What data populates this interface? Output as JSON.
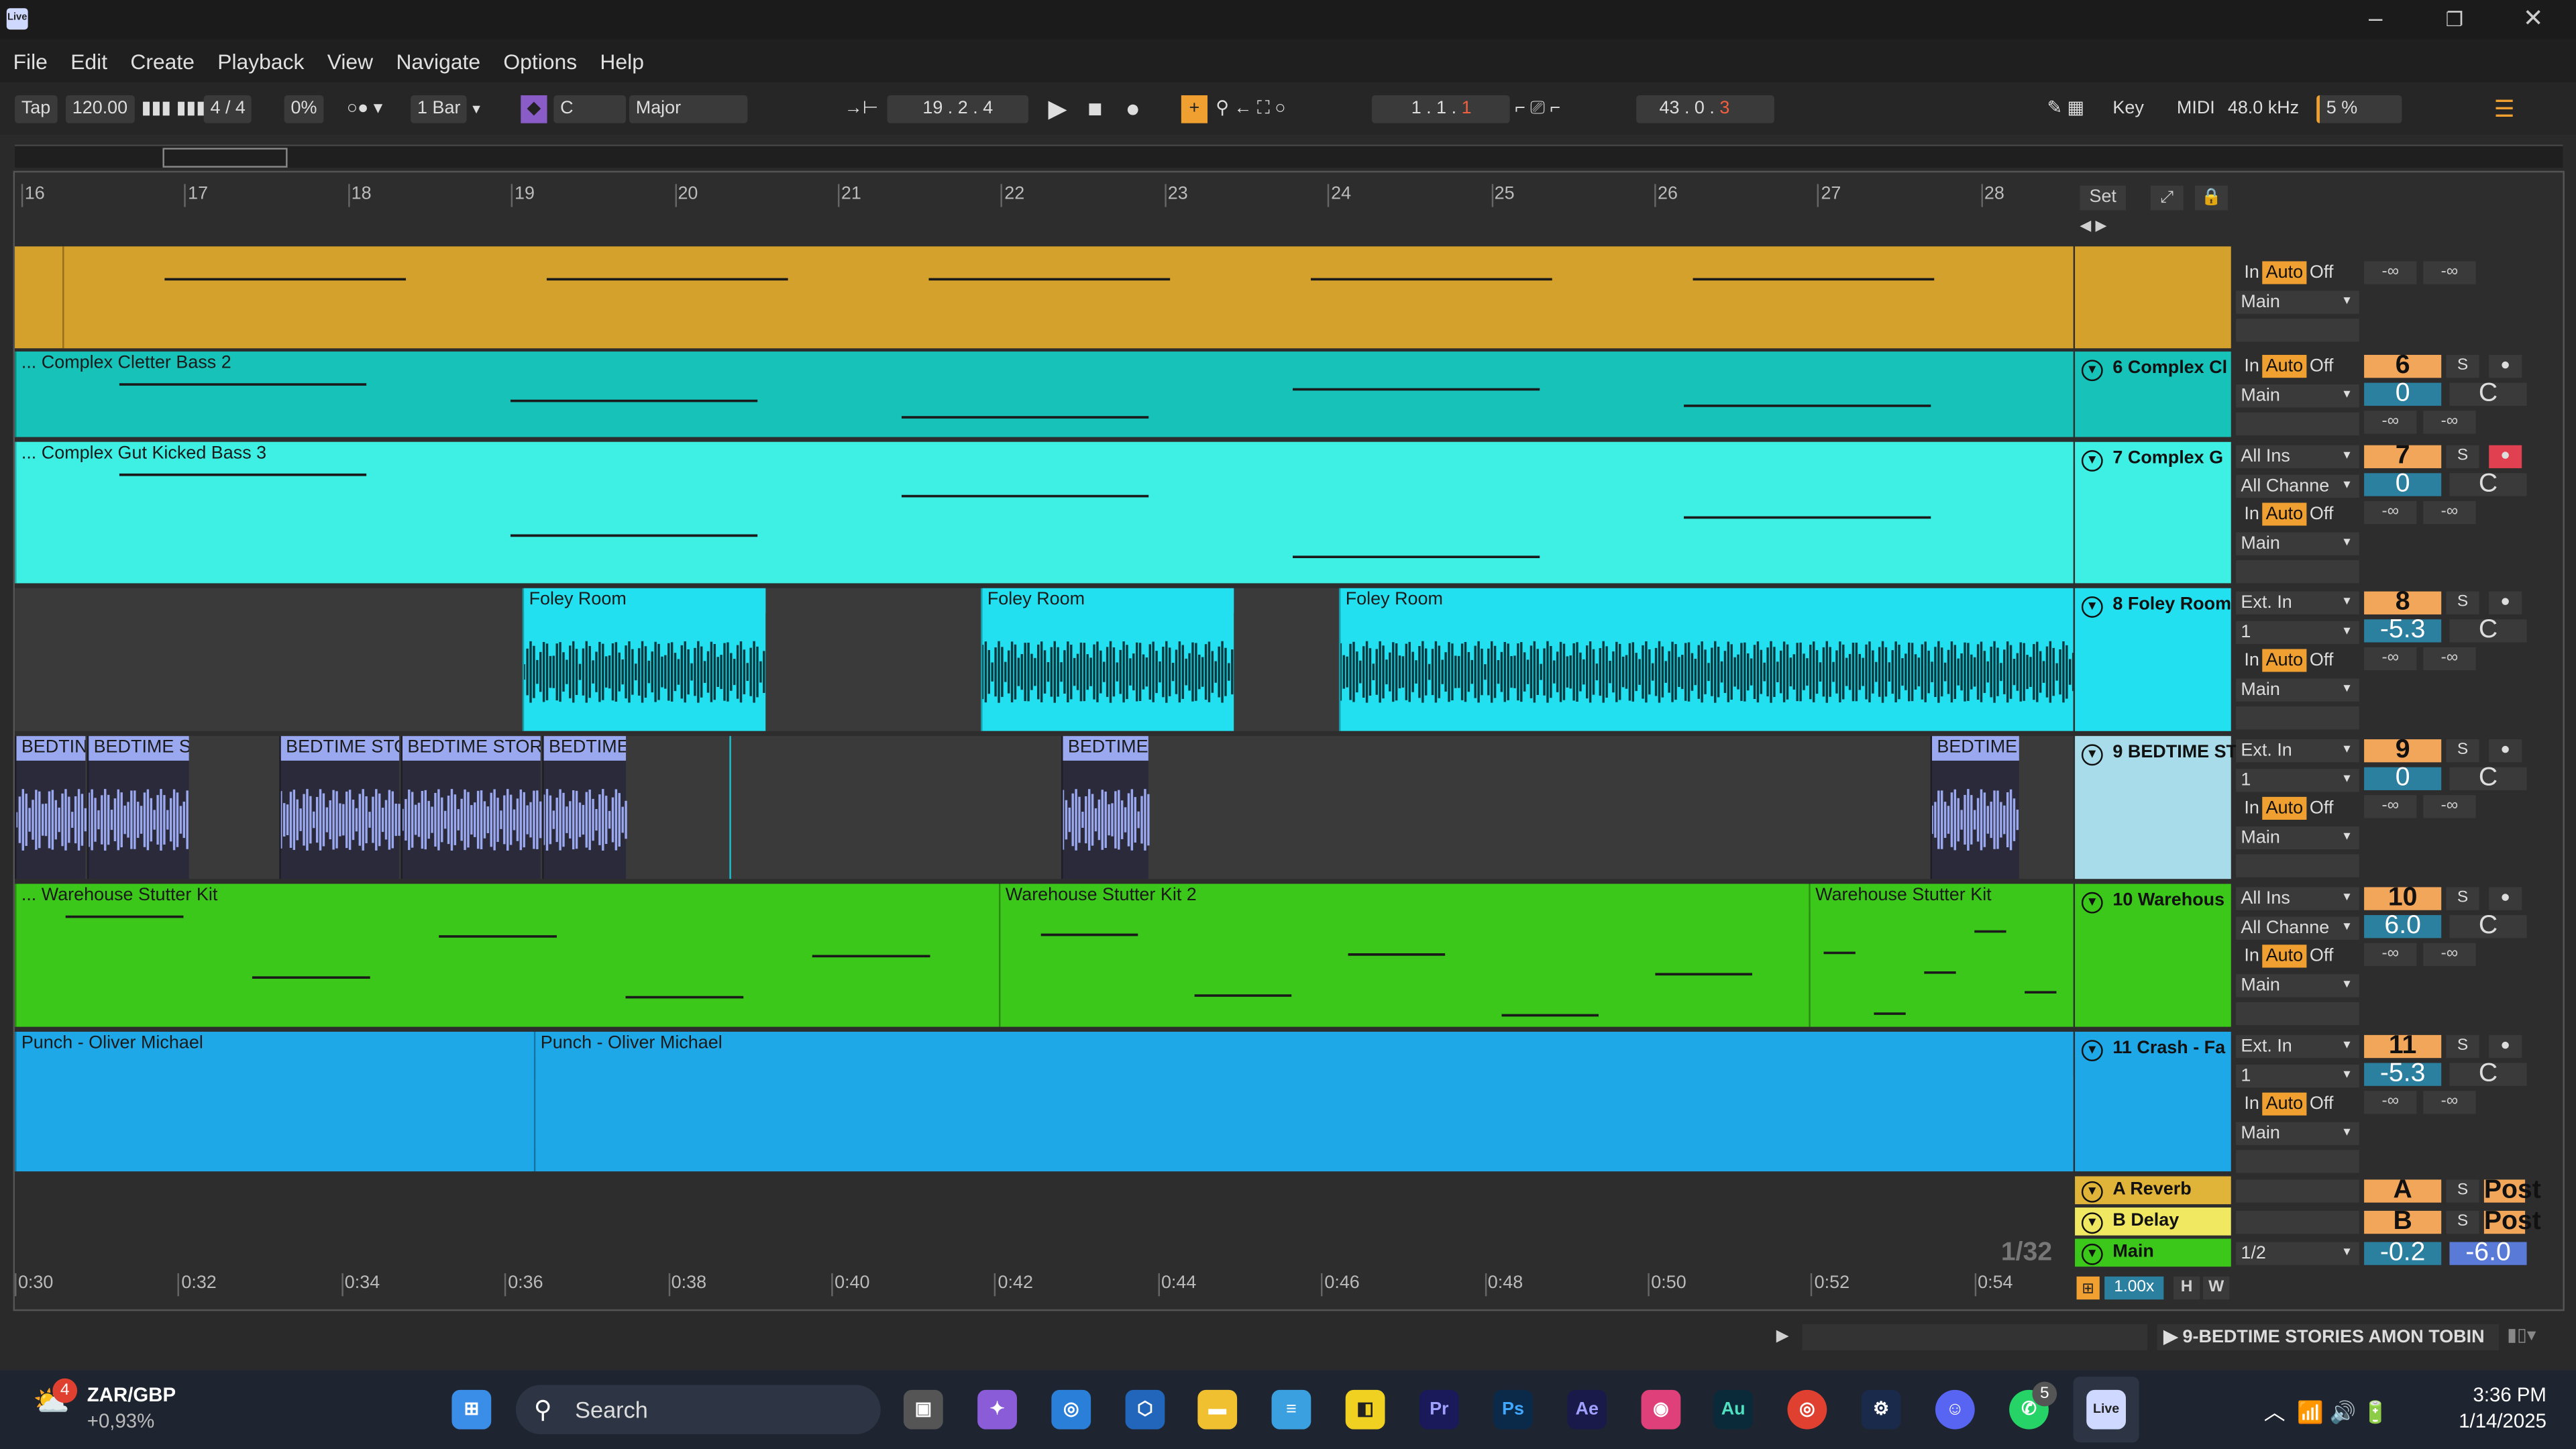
{
  "app": {
    "logo_text": "Live"
  },
  "menu": [
    "File",
    "Edit",
    "Create",
    "Playback",
    "View",
    "Navigate",
    "Options",
    "Help"
  ],
  "toolbar": {
    "tap": "Tap",
    "tempo": "120.00",
    "signature": "4 / 4",
    "groove": "0%",
    "quantize": "1 Bar",
    "key_root": "C",
    "scale": "Major",
    "position": "19 .   2 .   4",
    "loop_start": "1 .   1 .",
    "loop_start_beat": "1",
    "loop_len": "43 .   0 .",
    "loop_len_beat": "3",
    "key": "Key",
    "midi": "MIDI",
    "sample_rate": "48.0 kHz",
    "cpu": "5 %"
  },
  "ruler": {
    "bars": [
      "16",
      "17",
      "18",
      "19",
      "20",
      "21",
      "22",
      "23",
      "24",
      "25",
      "26",
      "27",
      "28"
    ],
    "set_label": "Set"
  },
  "timeline": {
    "times": [
      "0:30",
      "0:32",
      "0:34",
      "0:36",
      "0:38",
      "0:40",
      "0:42",
      "0:44",
      "0:46",
      "0:48",
      "0:50",
      "0:52",
      "0:54"
    ],
    "grid": "1/32"
  },
  "tracks": [
    {
      "id": "t5",
      "clip_titles": [],
      "header": "",
      "color": "#d4a12c",
      "io": [
        "In|Auto|Off",
        "Main",
        ""
      ],
      "num": "",
      "vol": "-∞",
      "pan": "-∞"
    },
    {
      "id": "t6",
      "clip_titles": [
        "... Complex Cletter Bass 2"
      ],
      "header": "6 Complex Cl",
      "color": "#17c2b8",
      "io": [
        "In|Auto|Off",
        "Main",
        ""
      ],
      "num": "6",
      "vol": "0",
      "pan": "C",
      "sends": [
        "-∞",
        "-∞"
      ]
    },
    {
      "id": "t7",
      "clip_titles": [
        "... Complex Gut Kicked Bass 3"
      ],
      "header": "7 Complex G",
      "color": "#3ef0e4",
      "io": [
        "All Ins",
        "All Channe",
        "In|Auto|Off",
        "Main",
        ""
      ],
      "num": "7",
      "vol": "0",
      "pan": "C",
      "sends": [
        "-∞",
        "-∞"
      ]
    },
    {
      "id": "t8",
      "clip_titles": [
        "Foley Room",
        "Foley Room",
        "Foley Room"
      ],
      "header": "8 Foley Room",
      "color": "#22e0f0",
      "io": [
        "Ext. In",
        "1",
        "In|Auto|Off",
        "Main",
        ""
      ],
      "num": "8",
      "vol": "-5.3",
      "pan": "C",
      "sends": [
        "-∞",
        "-∞"
      ]
    },
    {
      "id": "t9",
      "clip_titles": [
        "BEDTIN",
        "BEDTIME ST",
        "BEDTIME STOR",
        "BEDTIME STORIES",
        "BEDTIME S",
        "BEDTIME S",
        "BEDTIME S"
      ],
      "header": "9 BEDTIME ST",
      "color": "#a8dcea",
      "io": [
        "Ext. In",
        "1",
        "In|Auto|Off",
        "Main",
        ""
      ],
      "num": "9",
      "vol": "0",
      "pan": "C",
      "sends": [
        "-∞",
        "-∞"
      ]
    },
    {
      "id": "t10",
      "clip_titles": [
        "... Warehouse Stutter Kit",
        "Warehouse Stutter Kit 2",
        "Warehouse Stutter Kit"
      ],
      "header": "10 Warehous",
      "color": "#3cc81a",
      "io": [
        "All Ins",
        "All Channe",
        "In|Auto|Off",
        "Main",
        ""
      ],
      "num": "10",
      "vol": "6.0",
      "pan": "C",
      "sends": [
        "-∞",
        "-∞"
      ]
    },
    {
      "id": "t11",
      "clip_titles": [
        "Punch - Oliver Michael",
        "Punch - Oliver Michael"
      ],
      "header": "11 Crash - Fa",
      "color": "#1ea8e8",
      "io": [
        "Ext. In",
        "1",
        "In|Auto|Off",
        "Main",
        ""
      ],
      "num": "11",
      "vol": "-5.3",
      "pan": "C",
      "sends": [
        "-∞",
        "-∞"
      ]
    }
  ],
  "returns": [
    {
      "name": "A Reverb",
      "letter": "A",
      "post": "Post"
    },
    {
      "name": "B Delay",
      "letter": "B",
      "post": "Post"
    },
    {
      "name": "Main",
      "routing": "1/2",
      "vol": "-0.2",
      "pan": "-6.0"
    }
  ],
  "status": {
    "zoom": "1.00x",
    "h": "H",
    "w": "W",
    "selected": "9-BEDTIME STORIES AMON TOBIN"
  },
  "taskbar": {
    "ticker": "ZAR/GBP",
    "change": "+0,93%",
    "badge": "4",
    "search": "Search",
    "time": "3:36 PM",
    "date": "1/14/2025",
    "whatsapp_badge": "5"
  }
}
